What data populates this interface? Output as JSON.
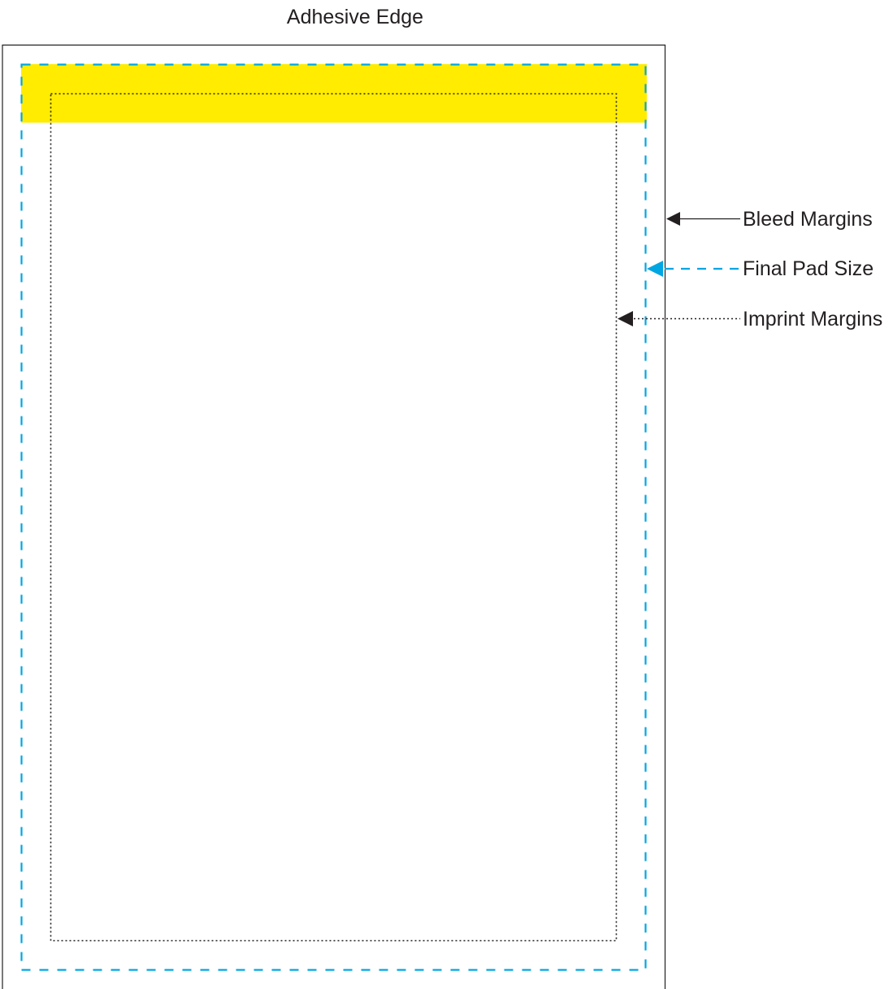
{
  "title": "Adhesive Edge",
  "legend": [
    {
      "key": "bleed",
      "label": "Bleed Margins",
      "color": "#231f20",
      "line_style": "solid"
    },
    {
      "key": "final",
      "label": "Final Pad Size",
      "color": "#00a6e2",
      "line_style": "dashed"
    },
    {
      "key": "imprint",
      "label": "Imprint Margins",
      "color": "#231f20",
      "line_style": "dotted"
    }
  ],
  "colors": {
    "adhesive_strip": "#ffec00",
    "bleed_border": "#231f20",
    "final_border": "#00a6e2",
    "imprint_border": "#231f20"
  }
}
